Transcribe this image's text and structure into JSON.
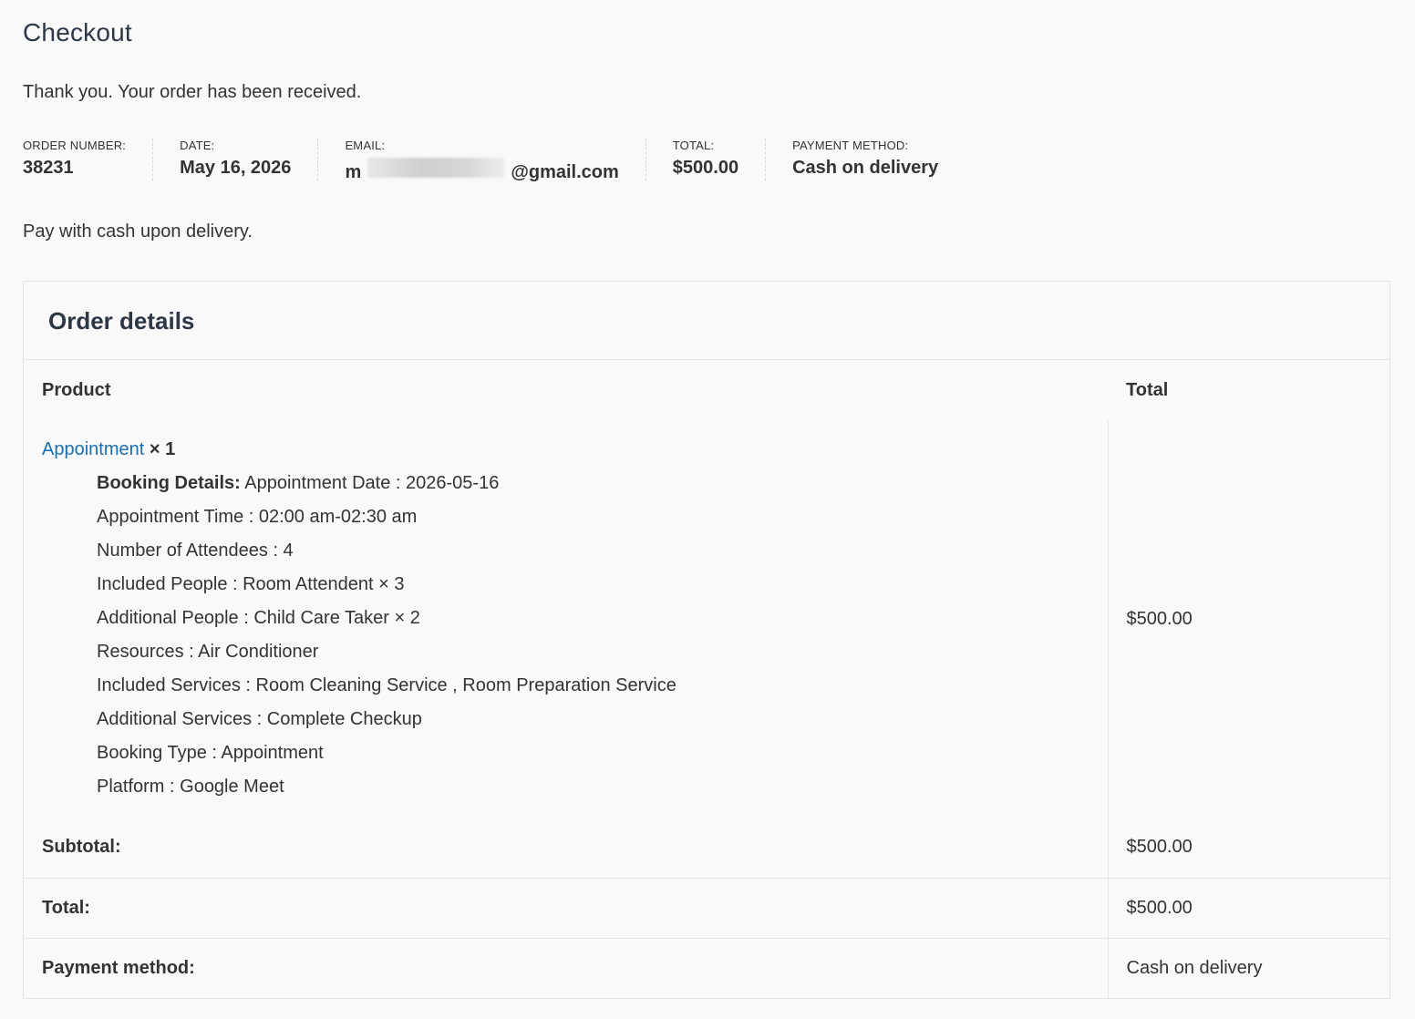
{
  "page": {
    "title": "Checkout",
    "thank_you": "Thank you. Your order has been received.",
    "payment_note": "Pay with cash upon delivery."
  },
  "overview": {
    "order_number": {
      "label": "ORDER NUMBER:",
      "value": "38231"
    },
    "date": {
      "label": "DATE:",
      "value": "May 16, 2026"
    },
    "email": {
      "label": "EMAIL:",
      "value_prefix": "m",
      "value_suffix": "@gmail.com"
    },
    "total": {
      "label": "TOTAL:",
      "value": "$500.00"
    },
    "payment_method": {
      "label": "PAYMENT METHOD:",
      "value": "Cash on delivery"
    }
  },
  "order_details": {
    "heading": "Order details",
    "columns": {
      "product": "Product",
      "total": "Total"
    },
    "item": {
      "name": "Appointment",
      "quantity": "× 1",
      "total": "$500.00",
      "meta": {
        "booking_label": "Booking Details:",
        "booking_value": "Appointment Date : 2026-05-16",
        "lines": [
          "Appointment Time : 02:00 am-02:30 am",
          "Number of Attendees : 4",
          "Included People : Room Attendent × 3",
          "Additional People : Child Care Taker × 2",
          "Resources : Air Conditioner",
          "Included Services : Room Cleaning Service , Room Preparation Service",
          "Additional Services : Complete Checkup",
          "Booking Type : Appointment",
          "Platform : Google Meet"
        ]
      }
    },
    "totals": [
      {
        "label": "Subtotal:",
        "value": "$500.00"
      },
      {
        "label": "Total:",
        "value": "$500.00"
      },
      {
        "label": "Payment method:",
        "value": "Cash on delivery"
      }
    ]
  },
  "colors": {
    "background": "#f9f9f9",
    "link": "#1a6fb0",
    "text": "#333333",
    "border": "#e4e4e4"
  }
}
